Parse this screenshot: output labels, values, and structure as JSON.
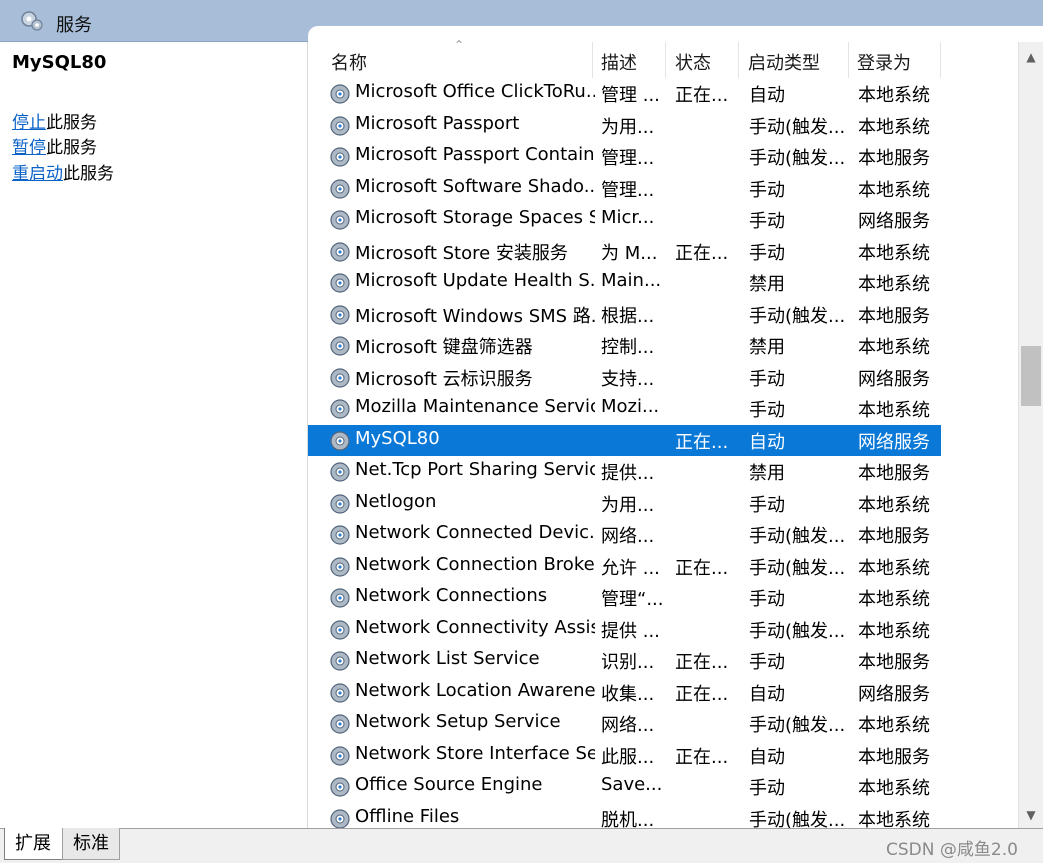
{
  "header": {
    "title": "服务"
  },
  "left_panel": {
    "service_name": "MySQL80",
    "actions": [
      {
        "link": "停止",
        "suffix": "此服务"
      },
      {
        "link": "暂停",
        "suffix": "此服务"
      },
      {
        "link": "重启动",
        "suffix": "此服务"
      }
    ]
  },
  "columns": [
    "名称",
    "描述",
    "状态",
    "启动类型",
    "登录为"
  ],
  "rows": [
    {
      "name": "Microsoft Office ClickToRu...",
      "desc": "管理 ...",
      "status": "正在...",
      "start": "自动",
      "login": "本地系统"
    },
    {
      "name": "Microsoft Passport",
      "desc": "为用...",
      "status": "",
      "start": "手动(触发...",
      "login": "本地系统"
    },
    {
      "name": "Microsoft Passport Container",
      "desc": "管理...",
      "status": "",
      "start": "手动(触发...",
      "login": "本地服务"
    },
    {
      "name": "Microsoft Software Shado...",
      "desc": "管理...",
      "status": "",
      "start": "手动",
      "login": "本地系统"
    },
    {
      "name": "Microsoft Storage Spaces S...",
      "desc": "Micr...",
      "status": "",
      "start": "手动",
      "login": "网络服务"
    },
    {
      "name": "Microsoft Store 安装服务",
      "desc": "为 M...",
      "status": "正在...",
      "start": "手动",
      "login": "本地系统"
    },
    {
      "name": "Microsoft Update Health S...",
      "desc": "Main...",
      "status": "",
      "start": "禁用",
      "login": "本地系统"
    },
    {
      "name": "Microsoft Windows SMS 路...",
      "desc": "根据...",
      "status": "",
      "start": "手动(触发...",
      "login": "本地服务"
    },
    {
      "name": "Microsoft 键盘筛选器",
      "desc": "控制...",
      "status": "",
      "start": "禁用",
      "login": "本地系统"
    },
    {
      "name": "Microsoft 云标识服务",
      "desc": "支持...",
      "status": "",
      "start": "手动",
      "login": "网络服务"
    },
    {
      "name": "Mozilla Maintenance Service",
      "desc": "Mozi...",
      "status": "",
      "start": "手动",
      "login": "本地系统"
    },
    {
      "name": "MySQL80",
      "desc": "",
      "status": "正在...",
      "start": "自动",
      "login": "网络服务",
      "selected": true
    },
    {
      "name": "Net.Tcp Port Sharing Service",
      "desc": "提供...",
      "status": "",
      "start": "禁用",
      "login": "本地服务"
    },
    {
      "name": "Netlogon",
      "desc": "为用...",
      "status": "",
      "start": "手动",
      "login": "本地系统"
    },
    {
      "name": "Network Connected Devic...",
      "desc": "网络...",
      "status": "",
      "start": "手动(触发...",
      "login": "本地服务"
    },
    {
      "name": "Network Connection Broker",
      "desc": "允许 ...",
      "status": "正在...",
      "start": "手动(触发...",
      "login": "本地系统"
    },
    {
      "name": "Network Connections",
      "desc": "管理“...",
      "status": "",
      "start": "手动",
      "login": "本地系统"
    },
    {
      "name": "Network Connectivity Assis...",
      "desc": "提供 ...",
      "status": "",
      "start": "手动(触发...",
      "login": "本地系统"
    },
    {
      "name": "Network List Service",
      "desc": "识别...",
      "status": "正在...",
      "start": "手动",
      "login": "本地服务"
    },
    {
      "name": "Network Location Awarene...",
      "desc": "收集...",
      "status": "正在...",
      "start": "自动",
      "login": "网络服务"
    },
    {
      "name": "Network Setup Service",
      "desc": "网络...",
      "status": "",
      "start": "手动(触发...",
      "login": "本地系统"
    },
    {
      "name": "Network Store Interface Se...",
      "desc": "此服...",
      "status": "正在...",
      "start": "自动",
      "login": "本地服务"
    },
    {
      "name": "Office  Source Engine",
      "desc": "Save...",
      "status": "",
      "start": "手动",
      "login": "本地系统"
    },
    {
      "name": "Offline Files",
      "desc": "脱机...",
      "status": "",
      "start": "手动(触发...",
      "login": "本地系统"
    }
  ],
  "bottom_tabs": [
    "扩展",
    "标准"
  ],
  "watermark": "CSDN @咸鱼2.0",
  "colors": {
    "header": "#a7bdd8",
    "selected_row": "#0a78d7",
    "link": "#0a62c7"
  }
}
